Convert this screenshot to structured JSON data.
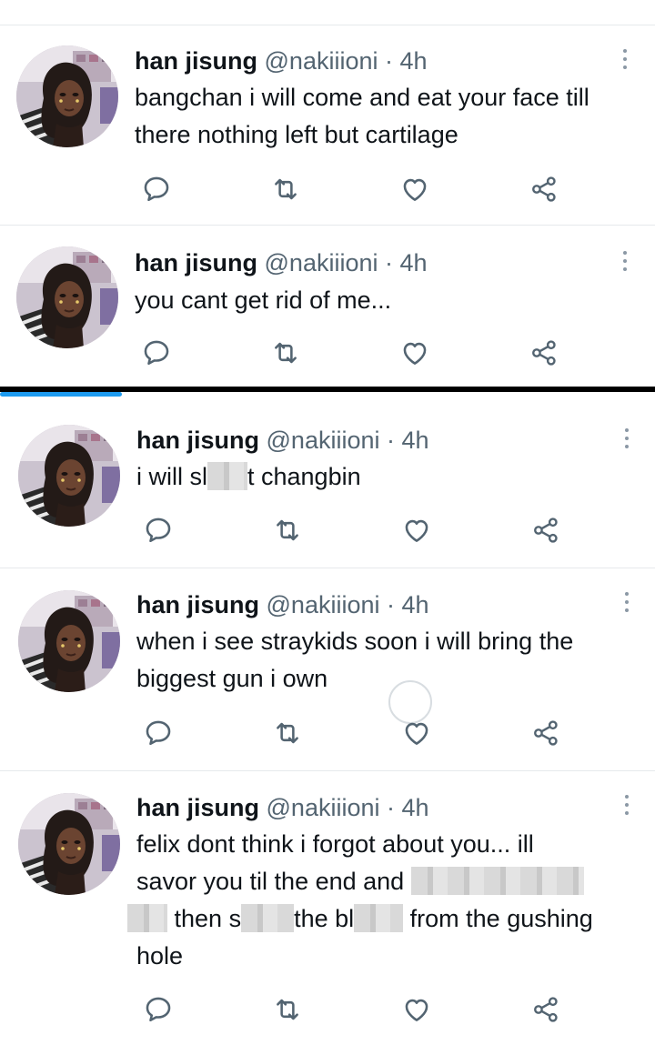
{
  "tweets": [
    {
      "name": "han jisung",
      "handle": "@nakiiioni",
      "dot": "·",
      "time": "4h",
      "text": "bangchan i will come and eat your face till there nothing left but cartilage"
    },
    {
      "name": "han jisung",
      "handle": "@nakiiioni",
      "dot": "·",
      "time": "4h",
      "text": "you cant get rid of me..."
    },
    {
      "name": "han jisung",
      "handle": "@nakiiioni",
      "dot": "·",
      "time": "4h",
      "text_a": "i will sl",
      "text_b": "t changbin"
    },
    {
      "name": "han jisung",
      "handle": "@nakiiioni",
      "dot": "·",
      "time": "4h",
      "text": "when i see straykids soon i will bring the biggest gun i own"
    },
    {
      "name": "han jisung",
      "handle": "@nakiiioni",
      "dot": "·",
      "time": "4h",
      "line1": "felix dont think i forgot about you... ill",
      "line2": "savor you til the end and",
      "line3_a": "then s",
      "line3_b": "the bl",
      "line3_c": "from the gushing",
      "line4": "hole"
    }
  ],
  "icons": {
    "reply": "reply-icon",
    "retweet": "retweet-icon",
    "like": "like-icon",
    "share": "share-icon",
    "more": "more-vertical-icon"
  },
  "colors": {
    "accent": "#1d9bf0",
    "icon": "#536471",
    "text": "#0f1419"
  }
}
